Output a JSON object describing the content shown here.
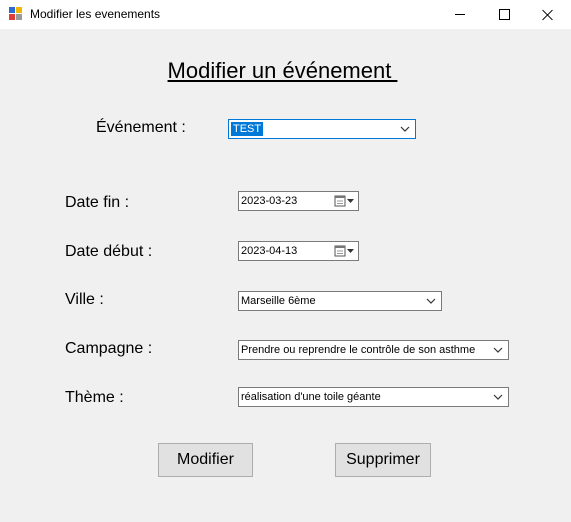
{
  "window": {
    "title": "Modifier les evenements"
  },
  "heading": "Modifier un événement ",
  "form": {
    "event": {
      "label": "Événement :",
      "value": "TEST"
    },
    "date_fin": {
      "label": "Date fin :",
      "value": "2023-03-23"
    },
    "date_debut": {
      "label": "Date début :",
      "value": "2023-04-13"
    },
    "ville": {
      "label": "Ville :",
      "value": "Marseille 6ème"
    },
    "campagne": {
      "label": "Campagne :",
      "value": "Prendre ou reprendre le contrôle de son asthme"
    },
    "theme": {
      "label": "Thème :",
      "value": "réalisation d'une toile géante"
    }
  },
  "buttons": {
    "modifier": "Modifier",
    "supprimer": "Supprimer"
  },
  "colors": {
    "selection": "#0078d7",
    "background": "#f0f0f0",
    "button": "#e1e1e1"
  },
  "icons": [
    "app-icon",
    "minimize-icon",
    "maximize-icon",
    "close-icon",
    "chevron-down-icon",
    "calendar-icon"
  ]
}
